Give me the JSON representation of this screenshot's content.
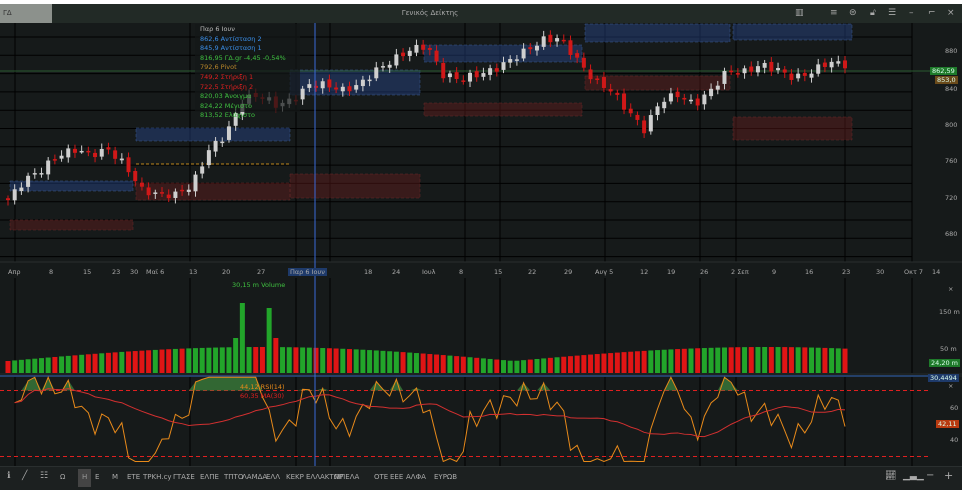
{
  "window": {
    "tab": "ΓΔ",
    "title": "Γενικός Δείκτης",
    "icons": [
      "chart-bars-icon",
      "hamburger-icon",
      "quote-icon",
      "lock-icon",
      "menu-icon",
      "minimize-icon",
      "maximize-icon",
      "close-icon"
    ]
  },
  "info": [
    "Παρ 6 Ιουν",
    "862,6 Αντίσταση 2",
    "845,9 Αντίσταση 1",
    "816,95 ΓΔ.gr -4,45 -0,54%",
    "792,6 Pivot",
    "749,2 Στήριξη 1",
    "722,5 Στήριξη 2",
    "820,03 Άνοιγμα",
    "824,22 Μέγιστο",
    "813,52 Ελάχιστο"
  ],
  "price_axis": [
    "880",
    "840",
    "800",
    "760",
    "720",
    "680"
  ],
  "price_labels": {
    "last": "862,59",
    "other": "853,0"
  },
  "date_axis": [
    "Απρ",
    "8",
    "15",
    "23",
    "30",
    "Μαϊ 6",
    "13",
    "20",
    "27",
    "Παρ 6 Ιουν",
    "18",
    "24",
    "Ιουλ",
    "8",
    "15",
    "22",
    "29",
    "Αυγ 5",
    "12",
    "19",
    "26",
    "2 Σεπ",
    "9",
    "16",
    "23",
    "30",
    "Οκτ 7",
    "14"
  ],
  "volume": {
    "label": "30,15 m Volume",
    "axis": [
      "150 m",
      "50 m"
    ],
    "last": "24,20 m",
    "rsi_top": "30,4494"
  },
  "rsi": {
    "label1": "44,12 RSI(14)",
    "label2": "60,35 MA(30)",
    "axis": [
      "60",
      "40"
    ],
    "last": "42,11"
  },
  "toolbar": {
    "tools": [
      "info-icon",
      "draw-line-icon",
      "grid-icon"
    ],
    "buttons": [
      "Ω",
      "Η",
      "Ε",
      "Μ",
      "ΕΤΕ",
      "ΤΡΚΗ.cy",
      "ΓΤΑΣΕ",
      "ΕΛΠΕ",
      "ΤΠΤΟ",
      "ΛΑΜΔΑ",
      "ΕΛΛ",
      "ΚΕΚΡ",
      "ΕΛΛΑΚΤΩΡ",
      "ΜΠΕΛΑ",
      "ΟΤΕ",
      "ΕΕΕ",
      "ΑΛΦΑ",
      "ΕΥΡΩΒ"
    ],
    "right": [
      "chart-type-icon",
      "bar-chart-icon",
      "zoom-out-icon",
      "zoom-in-icon"
    ]
  },
  "chart_data": {
    "type": "candlestick",
    "title": "Γενικός Δείκτης",
    "ylim": [
      660,
      900
    ],
    "close_keyframes": [
      716,
      738,
      749,
      765,
      771,
      766,
      771,
      754,
      727,
      722,
      722,
      732,
      771,
      787,
      825,
      831,
      820,
      825,
      842,
      842,
      836,
      842,
      858,
      869,
      880,
      885,
      853,
      848,
      853,
      858,
      869,
      880,
      891,
      893,
      869,
      847,
      836,
      814,
      793,
      825,
      831,
      820,
      836,
      858,
      856,
      864,
      858,
      849,
      856,
      867,
      864
    ],
    "colors": {
      "up": "#cfcfcf",
      "down": "#d01818",
      "vol_up": "#22a52a",
      "vol_down": "#e01515",
      "rsi": "#e88a1a",
      "ma": "#d23030"
    }
  }
}
